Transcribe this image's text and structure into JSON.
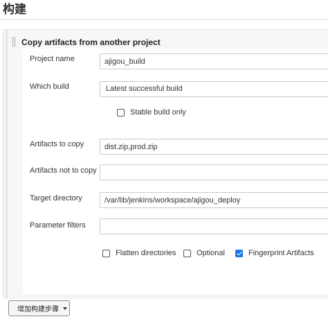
{
  "section": {
    "title": "构建"
  },
  "build_step": {
    "title": "Copy artifacts from another project",
    "fields": {
      "project_name": {
        "label": "Project name",
        "value": "ajigou_build"
      },
      "which_build": {
        "label": "Which build",
        "value": "Latest successful build"
      },
      "stable_only": {
        "label": "Stable build only",
        "checked": false
      },
      "artifacts_to_copy": {
        "label": "Artifacts to copy",
        "value": "dist.zip,prod.zip"
      },
      "artifacts_not_to_copy": {
        "label": "Artifacts not to copy",
        "value": ""
      },
      "target_directory": {
        "label": "Target directory",
        "value": "/var/lib/jenkins/workspace/ajigou_deploy"
      },
      "parameter_filters": {
        "label": "Parameter filters",
        "value": ""
      }
    },
    "options": {
      "flatten": {
        "label": "Flatten directories",
        "checked": false
      },
      "optional": {
        "label": "Optional",
        "checked": false
      },
      "fingerprint": {
        "label": "Fingerprint Artifacts",
        "checked": true
      }
    }
  },
  "add_step": {
    "label": "增加构建步骤"
  },
  "icons": {
    "drag_handle": "drag-handle-icon",
    "dropdown": "chevron-down-icon",
    "checkmark": "check-icon"
  },
  "colors": {
    "checkbox_accent": "#1a73e8",
    "panel_bg": "#f4f4f4"
  }
}
